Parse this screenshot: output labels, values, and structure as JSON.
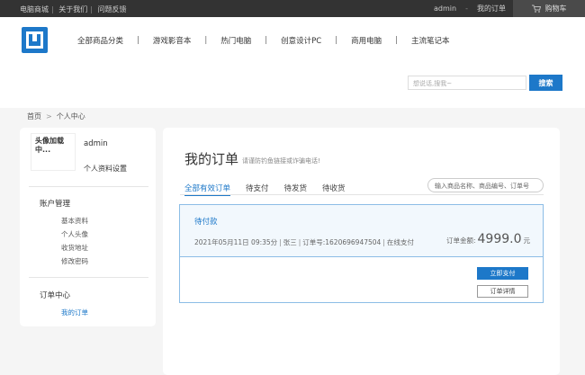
{
  "topbar": {
    "links": [
      "电脑商城",
      "关于我们",
      "问题反馈"
    ],
    "separator": "|",
    "username": "admin",
    "dash": "-",
    "my_orders": "我的订单",
    "cart": "购物车"
  },
  "header": {
    "nav": [
      "全部商品分类",
      "游戏影音本",
      "热门电脑",
      "创意设计PC",
      "商用电脑",
      "主流笔记本"
    ],
    "nav_separator": "|",
    "search_placeholder": "想说话,搜我~",
    "search_button": "搜索"
  },
  "breadcrumb": {
    "home": "首页",
    "gt": ">",
    "current": "个人中心"
  },
  "sidebar": {
    "avatar_text": "头像加载中...",
    "username": "admin",
    "profile_settings": "个人资料设置",
    "account_group": "账户管理",
    "account_links": [
      "基本资料",
      "个人头像",
      "收货地址",
      "修改密码"
    ],
    "order_group": "订单中心",
    "order_links": [
      "我的订单"
    ]
  },
  "main": {
    "title": "我的订单",
    "tip": "请谨防钓鱼链接或诈骗电话!",
    "tabs": [
      "全部有效订单",
      "待支付",
      "待发货",
      "待收货"
    ],
    "order_search_placeholder": "输入商品名称、商品编号、订单号",
    "order": {
      "status": "待付款",
      "datetime": "2021年05月11日 09:35分",
      "customer": "张三",
      "order_no_label": "订单号:",
      "order_no": "1620696947504",
      "payment": "在线支付",
      "sep": "|",
      "total_label": "订单金额:",
      "total_amount": "4999.0",
      "currency": "元",
      "pay_button": "立即支付",
      "detail_button": "订单详情"
    }
  },
  "colors": {
    "accent": "#1d78c9",
    "topbar_bg": "#333333",
    "page_bg": "#f5f5f5"
  }
}
